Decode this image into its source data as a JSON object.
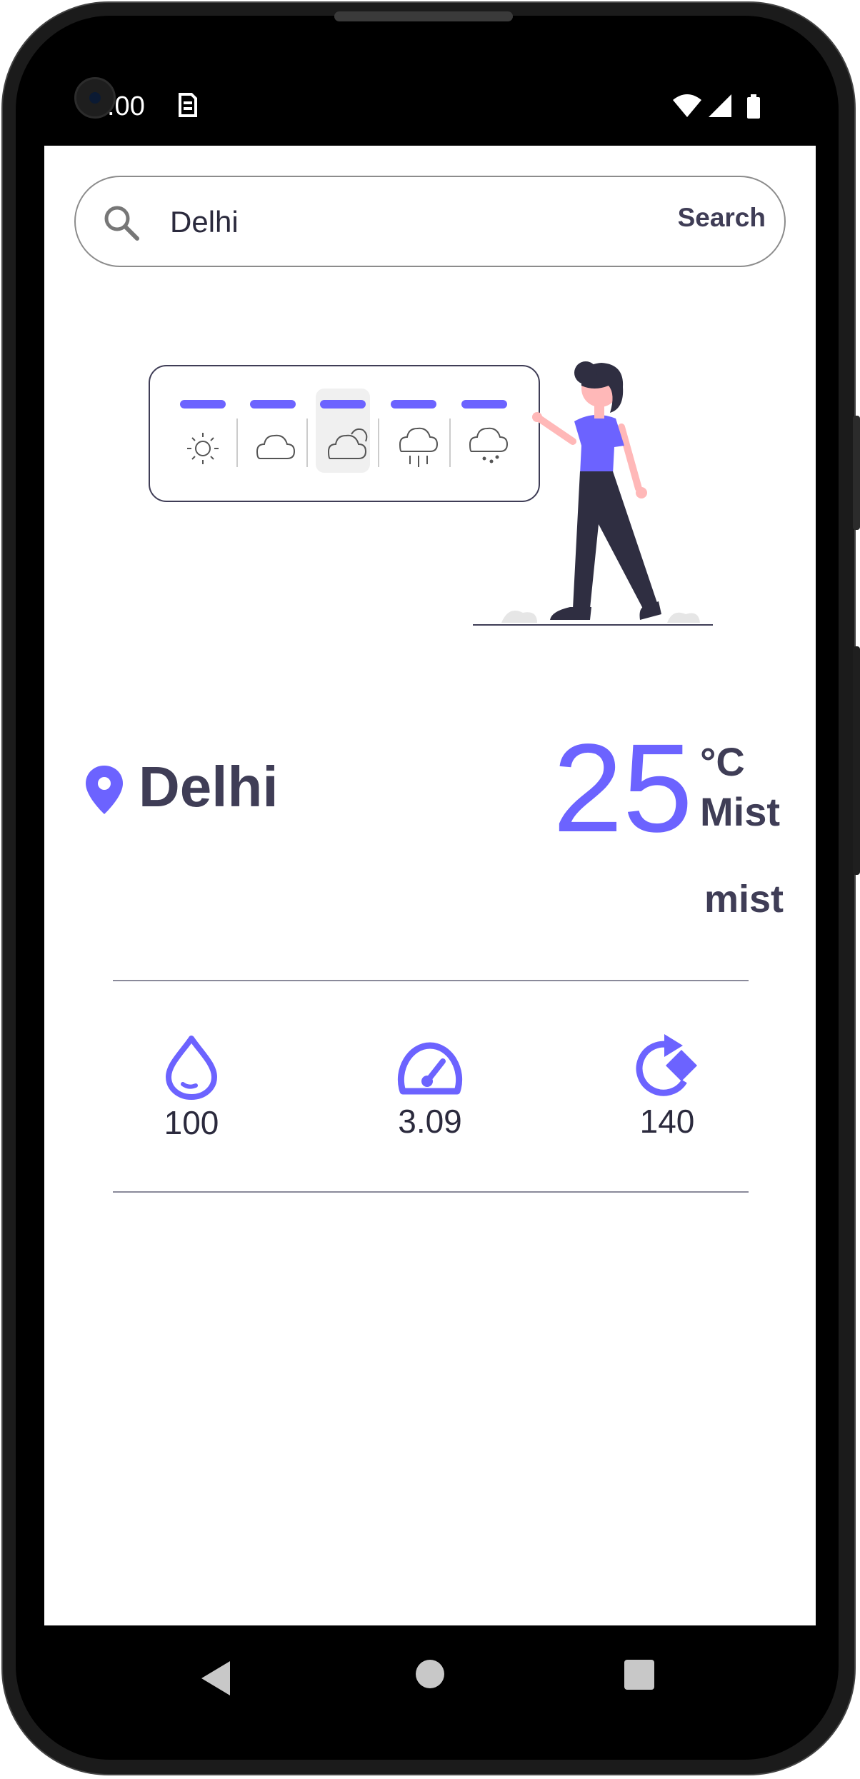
{
  "status_bar": {
    "time": ":00"
  },
  "search": {
    "value": "Delhi",
    "button_label": "Search"
  },
  "weather": {
    "city": "Delhi",
    "temperature": "25",
    "unit": "°C",
    "condition": "Mist",
    "description": "mist"
  },
  "stats": {
    "humidity": "100",
    "wind_speed": "3.09",
    "wind_direction": "140"
  },
  "colors": {
    "accent": "#6c63ff",
    "text_dark": "#3f3d56"
  },
  "icons": {
    "search": "search-icon",
    "location": "location-pin-icon",
    "humidity": "water-drop-icon",
    "wind_speed": "speedometer-icon",
    "wind_direction": "rotate-direction-icon"
  }
}
